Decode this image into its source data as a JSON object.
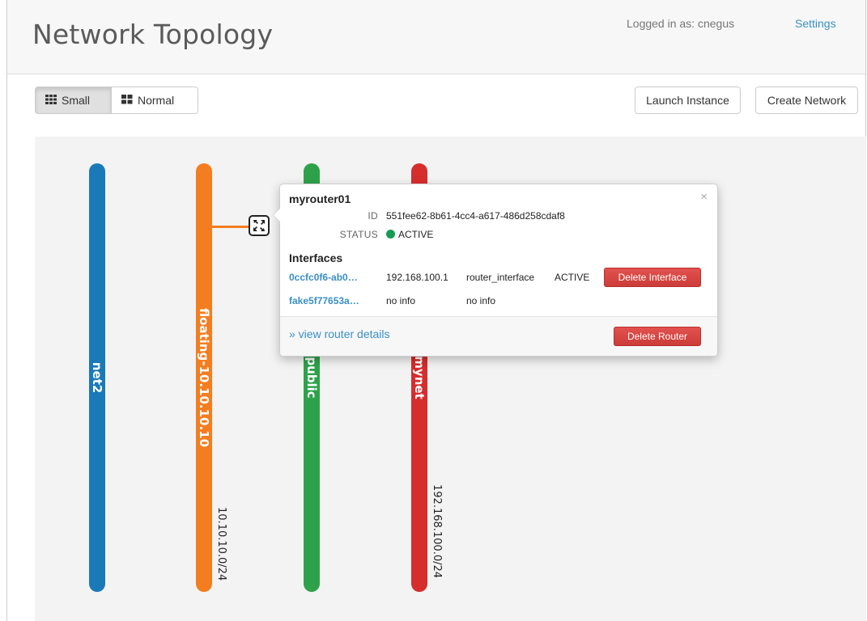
{
  "header": {
    "title": "Network Topology",
    "logged_in": "Logged in as: cnegus",
    "settings": "Settings"
  },
  "toolbar": {
    "small_label": "Small",
    "normal_label": "Normal",
    "launch_instance": "Launch Instance",
    "create_network": "Create Network"
  },
  "networks": [
    {
      "name": "net2",
      "color": "#1a7ab8",
      "cidr": ""
    },
    {
      "name": "floating-10.10.10.10",
      "color": "#f47d20",
      "cidr": "10.10.10.0/24"
    },
    {
      "name": "public",
      "color": "#2ea24a",
      "cidr": ""
    },
    {
      "name": "mynet",
      "color": "#d62d2d",
      "cidr": "192.168.100.0/24"
    }
  ],
  "router_popup": {
    "name": "myrouter01",
    "id_label": "ID",
    "id": "551fee62-8b61-4cc4-a617-486d258cdaf8",
    "status_label": "STATUS",
    "status": "ACTIVE",
    "status_color": "#169b52",
    "interfaces_heading": "Interfaces",
    "interfaces": [
      {
        "id": "0ccfc0f6-ab0…",
        "ip": "192.168.100.1",
        "type": "router_interface",
        "status": "ACTIVE",
        "action": "Delete Interface"
      },
      {
        "id": "fake5f77653a…",
        "ip": "no info",
        "type": "no info",
        "status": "",
        "action": ""
      }
    ],
    "view_details": "» view router details",
    "delete_router": "Delete Router",
    "close": "×"
  }
}
